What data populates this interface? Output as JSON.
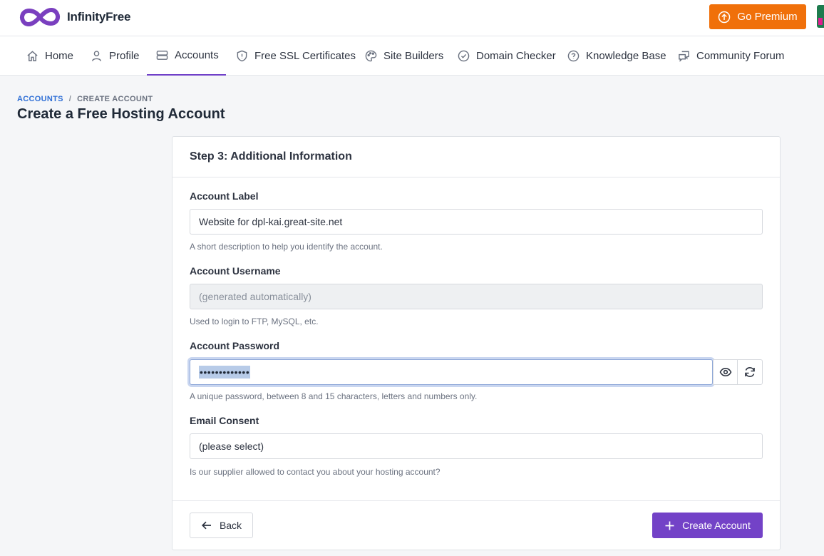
{
  "brand": {
    "name": "InfinityFree",
    "accent": "#7342c7"
  },
  "header": {
    "premium_label": "Go Premium",
    "premium_color": "#f0700a"
  },
  "nav": {
    "items": [
      {
        "label": "Home",
        "icon": "home-icon"
      },
      {
        "label": "Profile",
        "icon": "user-icon"
      },
      {
        "label": "Accounts",
        "icon": "server-icon",
        "active": true
      },
      {
        "label": "Free SSL Certificates",
        "icon": "shield-icon"
      },
      {
        "label": "Site Builders",
        "icon": "palette-icon"
      },
      {
        "label": "Domain Checker",
        "icon": "check-circle-icon"
      },
      {
        "label": "Knowledge Base",
        "icon": "question-circle-icon"
      },
      {
        "label": "Community Forum",
        "icon": "chat-icon"
      }
    ]
  },
  "breadcrumb": {
    "parent": "ACCOUNTS",
    "separator": "/",
    "current": "CREATE ACCOUNT"
  },
  "page_title": "Create a Free Hosting Account",
  "card": {
    "title": "Step 3: Additional Information",
    "account_label": {
      "label": "Account Label",
      "value": "Website for dpl-kai.great-site.net",
      "help": "A short description to help you identify the account."
    },
    "account_username": {
      "label": "Account Username",
      "placeholder": "(generated automatically)",
      "help": "Used to login to FTP, MySQL, etc."
    },
    "account_password": {
      "label": "Account Password",
      "masked_value": "•••••••••••••",
      "help": "A unique password, between 8 and 15 characters, letters and numbers only."
    },
    "email_consent": {
      "label": "Email Consent",
      "selected": "(please select)",
      "help": "Is our supplier allowed to contact you about your hosting account?"
    },
    "back_label": "Back",
    "create_label": "Create Account"
  }
}
